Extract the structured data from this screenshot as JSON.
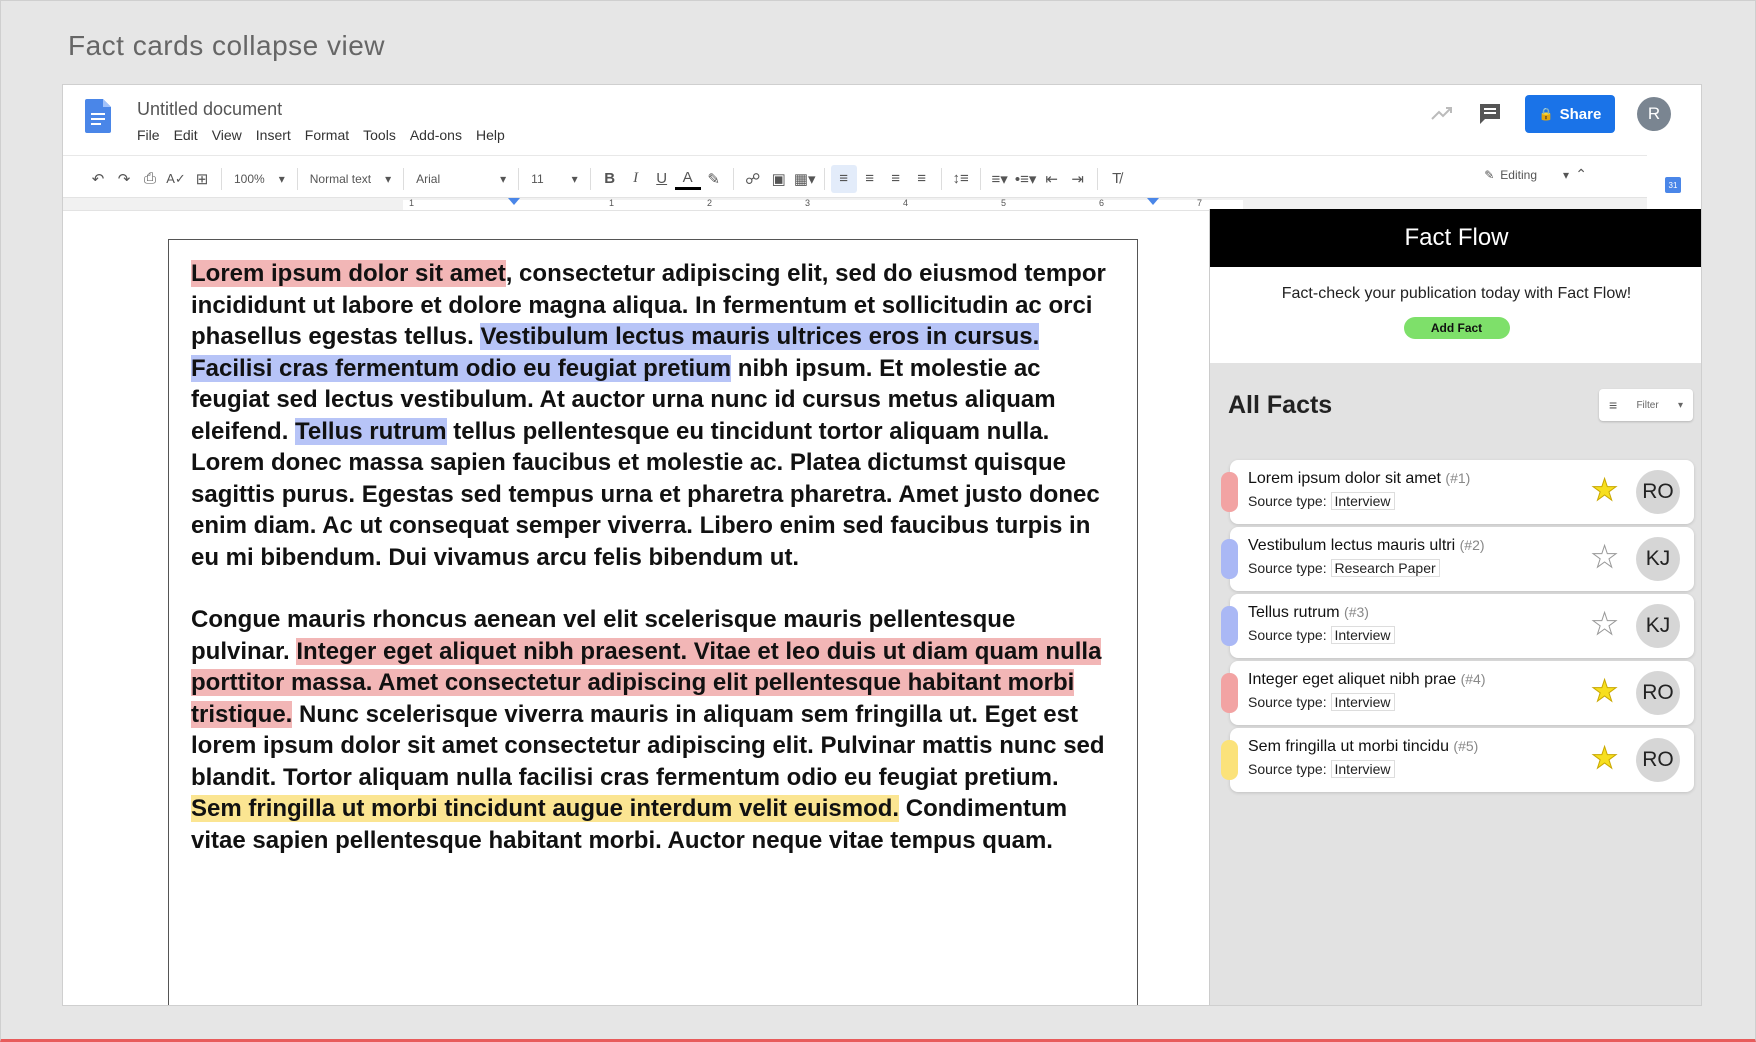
{
  "page_caption": "Fact cards collapse view",
  "doc": {
    "title": "Untitled document",
    "menu": [
      "File",
      "Edit",
      "View",
      "Insert",
      "Format",
      "Tools",
      "Add-ons",
      "Help"
    ]
  },
  "header": {
    "share_label": "Share",
    "user_initial": "R"
  },
  "toolbar": {
    "zoom": "100%",
    "style": "Normal text",
    "font": "Arial",
    "font_size": "11",
    "mode": "Editing"
  },
  "ruler": {
    "numbers": [
      "1",
      "1",
      "2",
      "3",
      "4",
      "5",
      "6",
      "7"
    ]
  },
  "document_text": {
    "p1": [
      {
        "t": "Lorem ipsum dolor sit amet",
        "hl": "red"
      },
      {
        "t": ", consectetur adipiscing elit, sed do eiusmod tempor incididunt ut labore et dolore magna aliqua. In fermentum et sollicitudin ac orci phasellus egestas tellus. ",
        "hl": ""
      },
      {
        "t": "Vestibulum lectus mauris ultrices eros in cursus. Facilisi cras fermentum odio eu feugiat pretium",
        "hl": "blue"
      },
      {
        "t": " nibh ipsum. Et molestie ac feugiat sed lectus vestibulum. At auctor urna nunc id cursus metus aliquam eleifend. ",
        "hl": ""
      },
      {
        "t": "Tellus rutrum",
        "hl": "blue"
      },
      {
        "t": " tellus pellentesque eu tincidunt tortor aliquam nulla. Lorem donec massa sapien faucibus et molestie ac. Platea dictumst quisque sagittis purus. Egestas sed tempus urna et pharetra pharetra. Amet justo donec enim diam. Ac ut consequat semper viverra. Libero enim sed faucibus turpis in eu mi bibendum. Dui vivamus arcu felis bibendum ut.",
        "hl": ""
      }
    ],
    "p2": [
      {
        "t": "Congue mauris rhoncus aenean vel elit scelerisque mauris pellentesque pulvinar. ",
        "hl": ""
      },
      {
        "t": "Integer eget aliquet nibh praesent. Vitae et leo duis ut diam quam nulla porttitor massa. Amet consectetur adipiscing elit pellentesque habitant morbi tristique.",
        "hl": "red"
      },
      {
        "t": " Nunc scelerisque viverra mauris in aliquam sem fringilla ut. Eget est lorem ipsum dolor sit amet consectetur adipiscing elit. Pulvinar mattis nunc sed blandit. Tortor aliquam nulla facilisi cras fermentum odio eu feugiat pretium. ",
        "hl": ""
      },
      {
        "t": "Sem fringilla ut morbi tincidunt augue interdum velit euismod.",
        "hl": "yellow"
      },
      {
        "t": " Condimentum vitae sapien pellentesque habitant morbi. Auctor neque vitae tempus quam.",
        "hl": ""
      }
    ]
  },
  "fact_flow": {
    "title": "Fact Flow",
    "tagline": "Fact-check your publication today with Fact Flow!",
    "add_fact_label": "Add Fact",
    "all_facts_title": "All Facts",
    "filter_label": "Filter",
    "source_prefix": "Source type:",
    "facts": [
      {
        "title": "Lorem ipsum dolor sit amet",
        "num": "(#1)",
        "source": "Interview",
        "color": "#f2a3a3",
        "starred": true,
        "assignee": "RO"
      },
      {
        "title": "Vestibulum lectus mauris ultri",
        "num": "(#2)",
        "source": "Research Paper",
        "color": "#aab8f5",
        "starred": false,
        "assignee": "KJ"
      },
      {
        "title": "Tellus rutrum",
        "num": "(#3)",
        "source": "Interview",
        "color": "#aab8f5",
        "starred": false,
        "assignee": "KJ"
      },
      {
        "title": "Integer eget aliquet nibh prae",
        "num": "(#4)",
        "source": "Interview",
        "color": "#f2a3a3",
        "starred": true,
        "assignee": "RO"
      },
      {
        "title": "Sem fringilla ut morbi tincidu",
        "num": "(#5)",
        "source": "Interview",
        "color": "#fbe27a",
        "starred": true,
        "assignee": "RO"
      }
    ]
  },
  "colors": {
    "share_blue": "#1a73e8",
    "add_fact_green": "#7ee06a",
    "highlight_red": "#f2b6b6",
    "highlight_blue": "#b7c4f7",
    "highlight_yellow": "#fbe592"
  }
}
